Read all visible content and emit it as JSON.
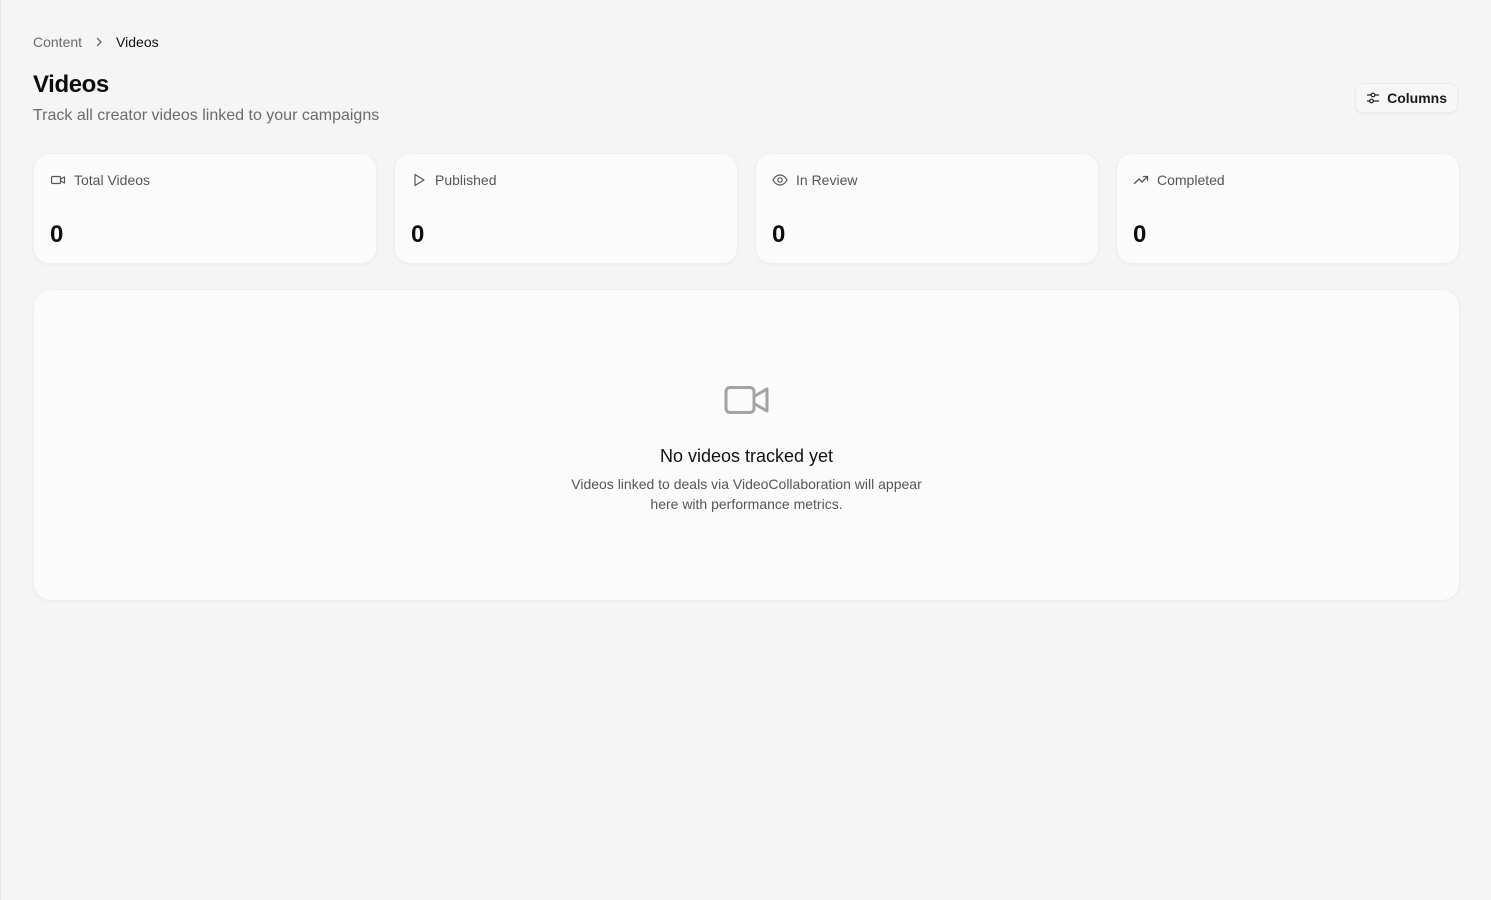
{
  "breadcrumb": {
    "parent": "Content",
    "current": "Videos"
  },
  "header": {
    "title": "Videos",
    "subtitle": "Track all creator videos linked to your campaigns",
    "columns_label": "Columns"
  },
  "stats": [
    {
      "label": "Total Videos",
      "value": "0",
      "icon": "video-icon"
    },
    {
      "label": "Published",
      "value": "0",
      "icon": "play-icon"
    },
    {
      "label": "In Review",
      "value": "0",
      "icon": "eye-icon"
    },
    {
      "label": "Completed",
      "value": "0",
      "icon": "trending-up-icon"
    }
  ],
  "empty_state": {
    "icon": "video-icon",
    "title": "No videos tracked yet",
    "description": "Videos linked to deals via VideoCollaboration will appear here with performance metrics."
  },
  "colors": {
    "background": "#f5f5f5",
    "card": "#fbfbfb",
    "muted_text": "#6b6b6b",
    "empty_icon": "#a3a3a3"
  }
}
